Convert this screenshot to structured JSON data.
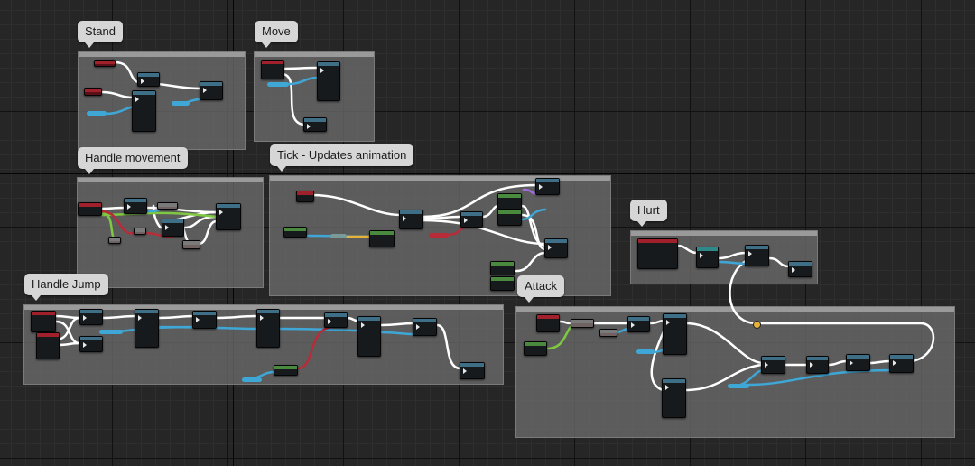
{
  "comments": {
    "stand": "Stand",
    "move": "Move",
    "handle_movement": "Handle movement",
    "tick": "Tick - Updates animation",
    "hurt": "Hurt",
    "handle_jump": "Handle Jump",
    "attack": "Attack"
  },
  "colors": {
    "event_header": "#a0202c",
    "function_header": "#3f6f86",
    "pure_header": "#4a8a3f",
    "exec_wire": "#ffffff",
    "object_wire": "#3fa7d6",
    "bool_wire": "#b82c3a",
    "float_wire": "#7ec842"
  }
}
